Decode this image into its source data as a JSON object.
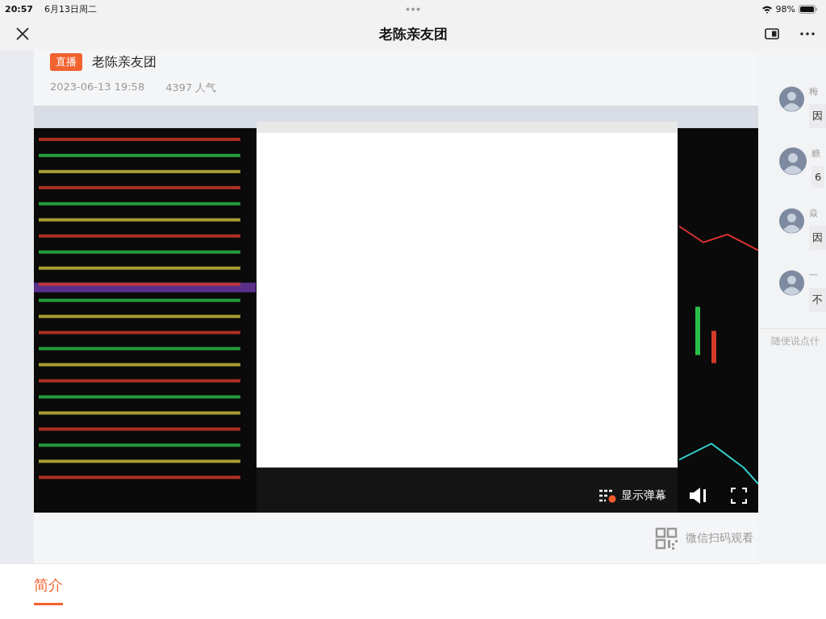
{
  "status_bar": {
    "time": "20:57",
    "date": "6月13日周二",
    "battery": "98%"
  },
  "nav": {
    "title": "老陈亲友团"
  },
  "live": {
    "badge": "直播",
    "title": "老陈亲友团",
    "date": "2023-06-13 19:58",
    "popularity": "4397 人气"
  },
  "video": {
    "kind": "picture",
    "danmaku_label": "显示弹幕"
  },
  "qr_hint": "微信扫码观看",
  "chat": {
    "messages": [
      {
        "name": "梅",
        "text": "因"
      },
      {
        "name": "糖",
        "text": "6"
      },
      {
        "name": "焱",
        "text": "因"
      },
      {
        "name": "一",
        "text": "不"
      }
    ],
    "input": {
      "placeholder": "随便说点什"
    }
  },
  "tabs": [
    {
      "label": "简介",
      "selected": true
    }
  ]
}
